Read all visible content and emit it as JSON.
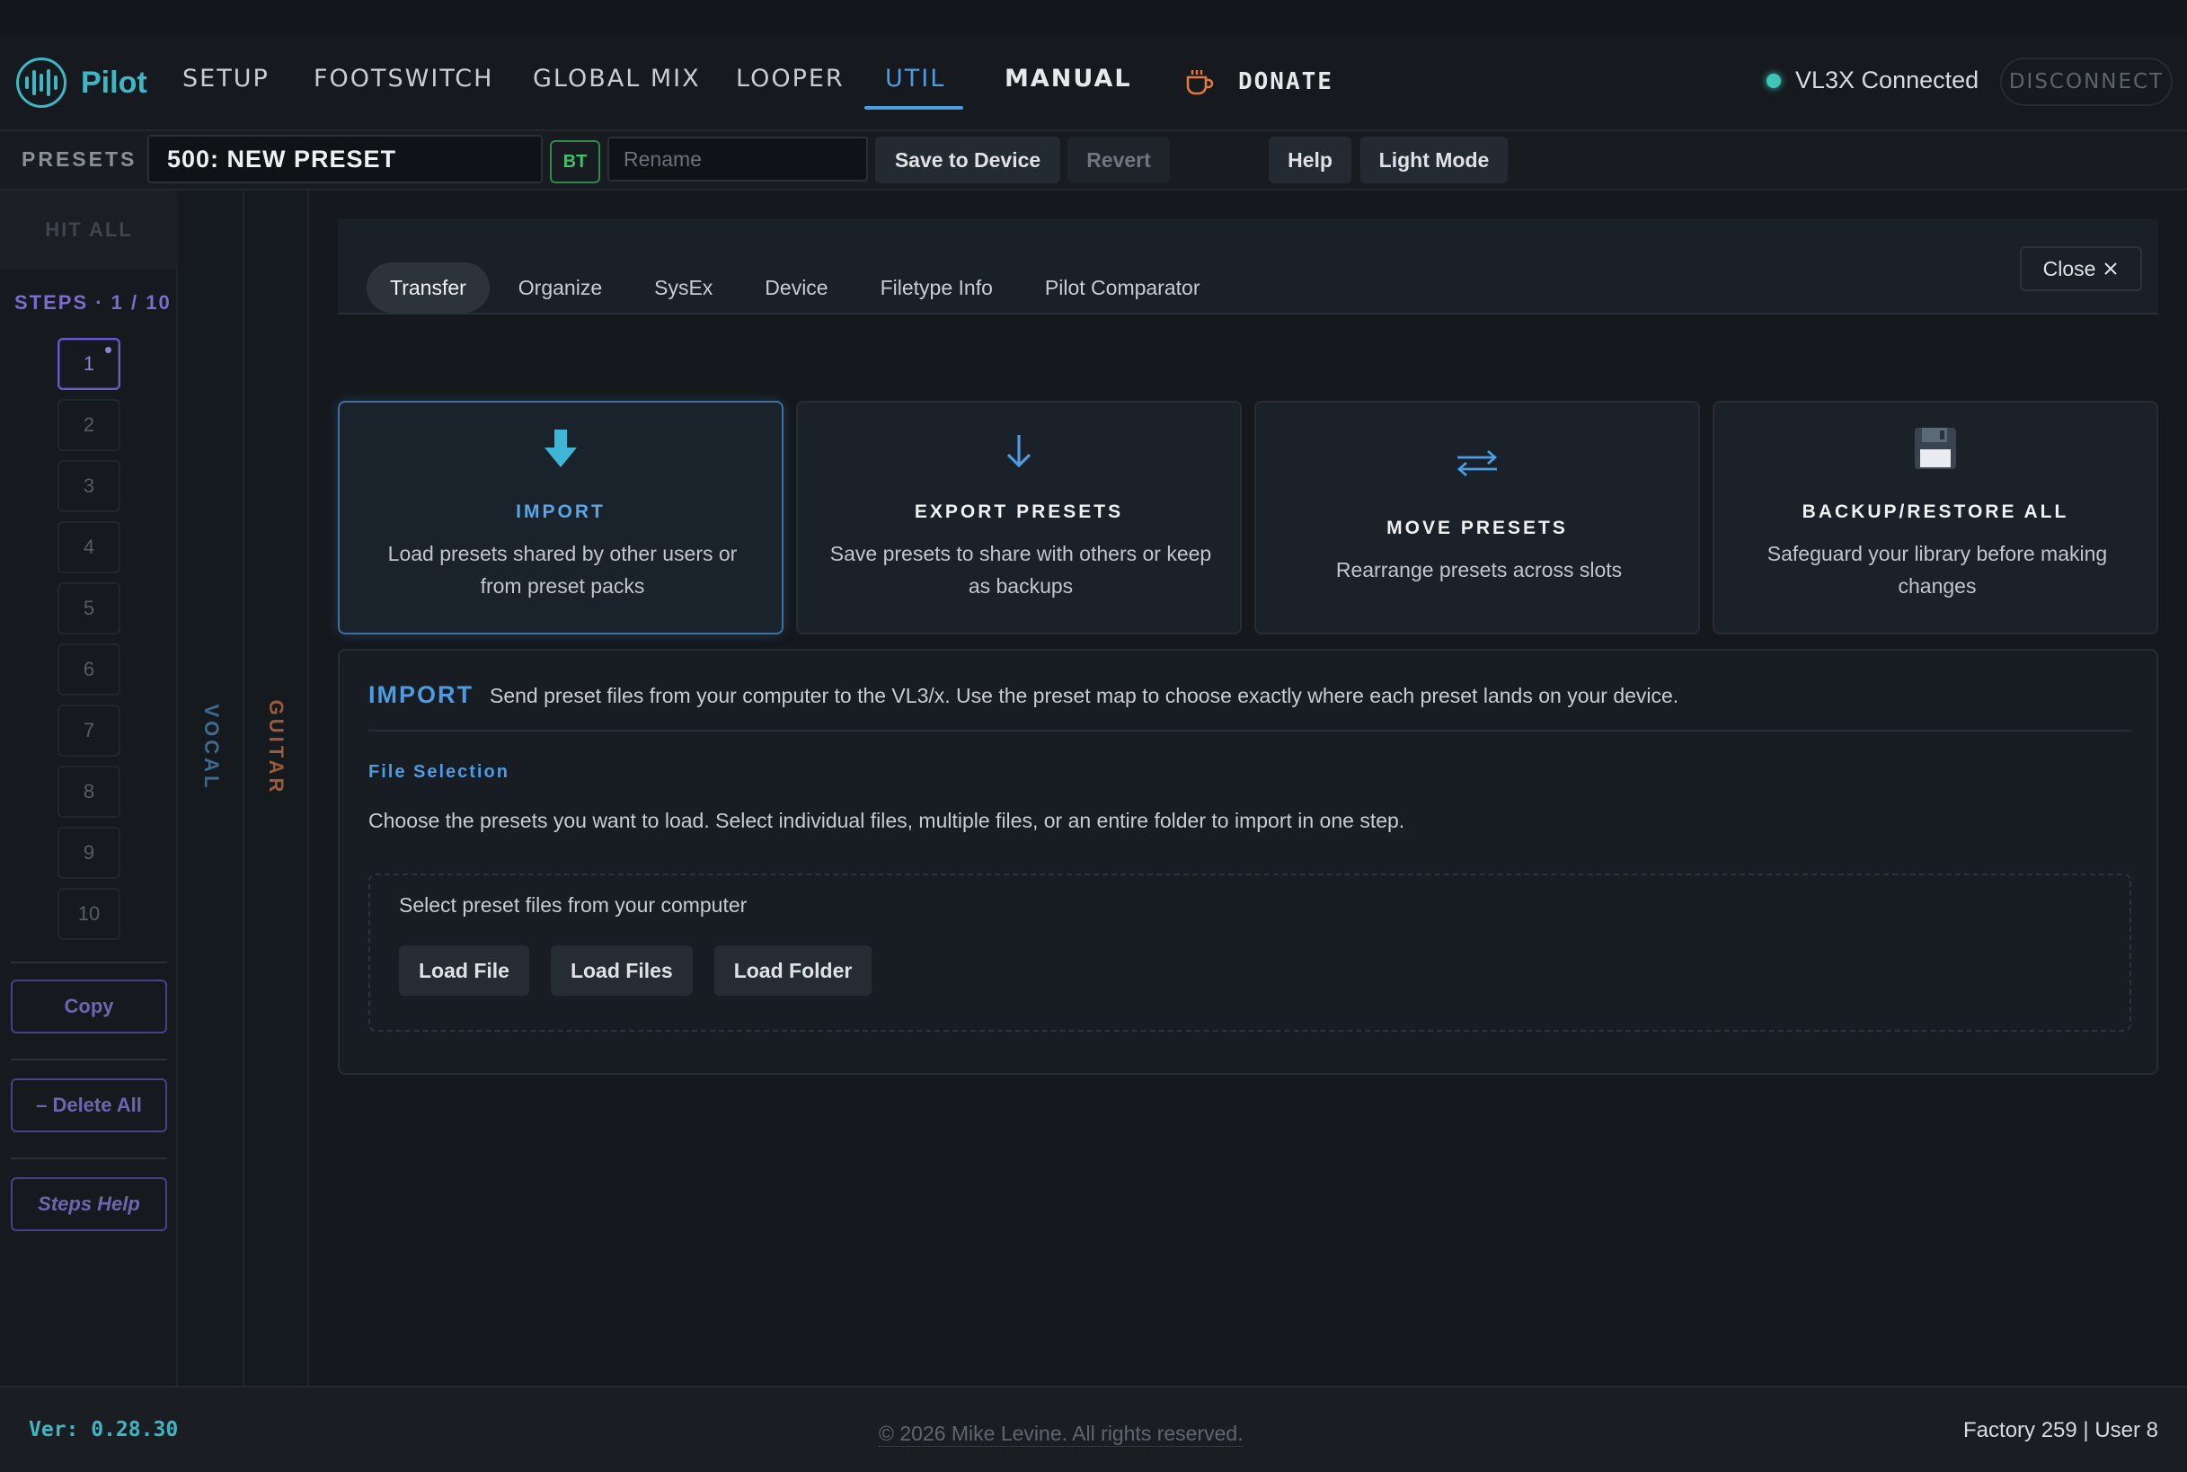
{
  "app": {
    "name": "Pilot",
    "version": "Ver: 0.28.30"
  },
  "nav": {
    "items": [
      "SETUP",
      "FOOTSWITCH",
      "GLOBAL MIX",
      "LOOPER",
      "UTIL",
      "MANUAL"
    ],
    "active": "UTIL",
    "donate": "DONATE",
    "status": "VL3X Connected",
    "disconnect": "DISCONNECT"
  },
  "presetbar": {
    "label": "PRESETS",
    "preset_name": "500: NEW PRESET",
    "bt_badge": "BT",
    "rename_placeholder": "Rename",
    "save": "Save to Device",
    "revert": "Revert",
    "help": "Help",
    "light_mode": "Light Mode"
  },
  "sidebar": {
    "hit_all": "HIT ALL",
    "steps_title": "STEPS · 1 / 10",
    "steps": [
      "1",
      "2",
      "3",
      "4",
      "5",
      "6",
      "7",
      "8",
      "9",
      "10"
    ],
    "active_step": "1",
    "copy": "Copy",
    "delete_all": "– Delete All",
    "steps_help": "Steps Help"
  },
  "strips": {
    "vocal": "VOCAL",
    "guitar": "GUITAR"
  },
  "util": {
    "tabs": [
      "Transfer",
      "Organize",
      "SysEx",
      "Device",
      "Filetype Info",
      "Pilot Comparator"
    ],
    "active_tab": "Transfer",
    "close": "Close",
    "cards": [
      {
        "title": "IMPORT",
        "desc": "Load presets shared by other users or from preset packs",
        "icon": "import-arrow-icon"
      },
      {
        "title": "EXPORT PRESETS",
        "desc": "Save presets to share with others or keep as backups",
        "icon": "export-arrow-icon"
      },
      {
        "title": "MOVE PRESETS",
        "desc": "Rearrange presets across slots",
        "icon": "swap-arrows-icon"
      },
      {
        "title": "BACKUP/RESTORE ALL",
        "desc": "Safeguard your library before making changes",
        "icon": "floppy-disk-icon"
      }
    ],
    "import": {
      "title": "IMPORT",
      "desc": "Send preset files from your computer to the VL3/x. Use the preset map to choose exactly where each preset lands on your device.",
      "file_selection_title": "File Selection",
      "file_selection_desc": "Choose the presets you want to load. Select individual files, multiple files, or an entire folder to import in one step.",
      "dropzone_title": "Select preset files from your computer",
      "buttons": [
        "Load File",
        "Load Files",
        "Load Folder"
      ]
    }
  },
  "footer": {
    "copyright": "© 2026 Mike Levine. All rights reserved.",
    "counts": "Factory 259 | User 8"
  },
  "colors": {
    "accent": "#4d9be0",
    "brand": "#3fb6c6",
    "steps": "#7a6cd0",
    "vocal": "#3d6a8e",
    "guitar": "#9a5a3c"
  }
}
